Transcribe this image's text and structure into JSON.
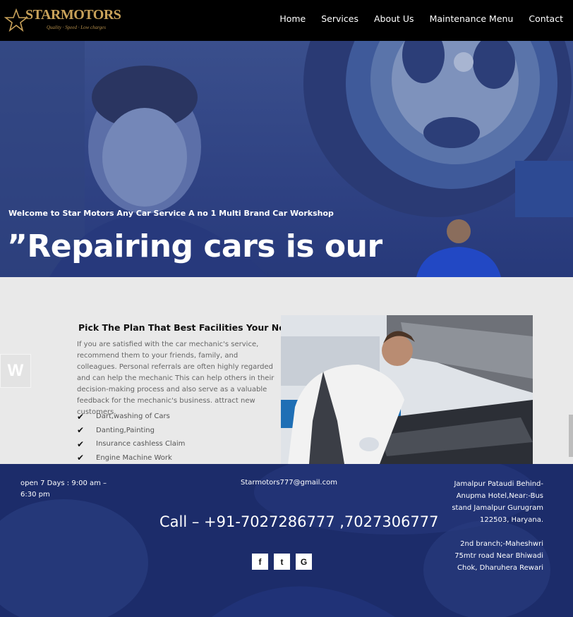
{
  "header": {
    "logo_text": "STARMOTORS",
    "logo_tagline": "Quality · Speed · Low charges",
    "nav": [
      "Home",
      "Services",
      "About Us",
      "Maintenance Menu",
      "Contact"
    ]
  },
  "hero": {
    "welcome": "Welcome to Star Motors Any Car Service A no 1 Multi Brand Car Workshop",
    "headline": "”Repairing cars is our"
  },
  "content": {
    "side_badge": "W",
    "title": "Pick The Plan That Best Facilities Your Needs",
    "description": "If you are satisfied with the car mechanic's service, recommend them to your friends, family, and colleagues. Personal referrals are often highly regarded and can help the mechanic This can help others in their decision-making process and also serve as a valuable feedback for the mechanic's business. attract new customers.",
    "features": [
      "Dart,washing of Cars",
      "Danting,Painting",
      "Insurance cashless Claim",
      "Engine Machine Work"
    ]
  },
  "footer": {
    "hours": "open 7 Days : 9:00 am – 6:30 pm",
    "email": "Starmotors777@gmail.com",
    "address_1": "Jamalpur Pataudi Behind-Anupma Hotel,Near:-Bus stand Jamalpur Gurugram 122503, Haryana.",
    "address_2": "2nd branch;-Maheshwri 75mtr road Near Bhiwadi Chok, Dharuhera Rewari",
    "call": "Call – +91-7027286777 ,7027306777",
    "socials": [
      {
        "icon": "facebook-icon",
        "glyph": "f"
      },
      {
        "icon": "twitter-icon",
        "glyph": "t"
      },
      {
        "icon": "google-icon",
        "glyph": "G"
      }
    ]
  },
  "colors": {
    "header_bg": "#000000",
    "hero_overlay": "#2f4283",
    "footer_bg": "#1e2f6e",
    "logo_gold": "#c9a25a"
  }
}
